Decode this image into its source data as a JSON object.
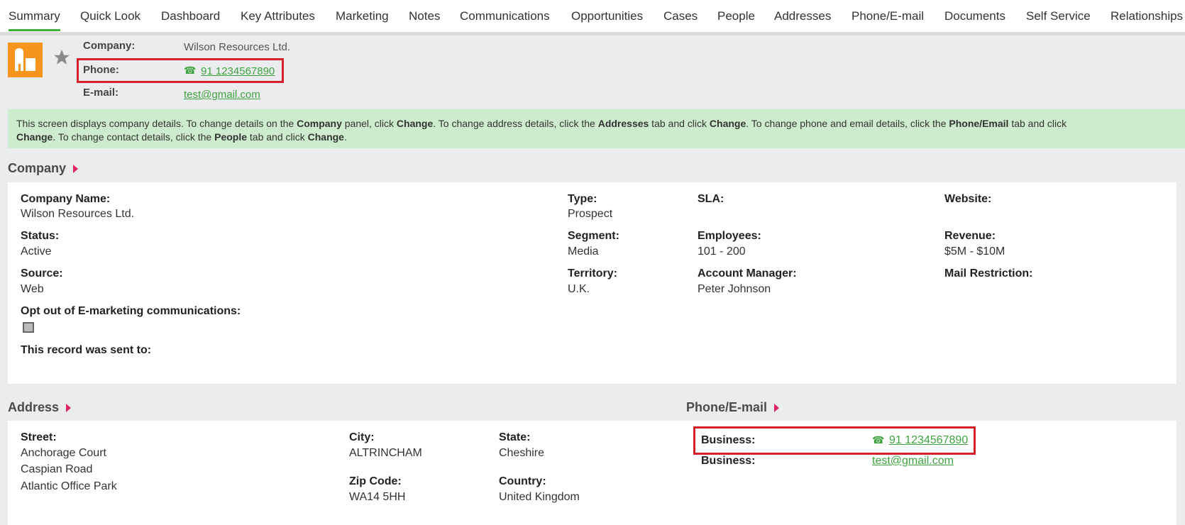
{
  "tabs": [
    "Summary",
    "Quick Look",
    "Dashboard",
    "Key Attributes",
    "Marketing",
    "Notes",
    "Communications",
    "Opportunities",
    "Cases",
    "People",
    "Addresses",
    "Phone/E-mail",
    "Documents",
    "Self Service",
    "Relationships"
  ],
  "header": {
    "company_label": "Company:",
    "company": "Wilson Resources Ltd.",
    "phone_label": "Phone:",
    "phone": "91 1234567890",
    "email_label": "E-mail:",
    "email": "test@gmail.com"
  },
  "notice": {
    "p1": "This screen displays company details. To change details on the ",
    "b1": "Company",
    "p2": " panel, click ",
    "b2": "Change",
    "p3": ". To change address details, click the ",
    "b3": "Addresses",
    "p4": " tab and click ",
    "b4": "Change",
    "p5": ". To change phone and email details, click the ",
    "b5": "Phone/Email",
    "p6": " tab and click ",
    "b6": "Change",
    "p7": ". To change contact details, click the ",
    "b7": "People",
    "p8": " tab and click ",
    "b8": "Change",
    "p9": "."
  },
  "company": {
    "heading": "Company",
    "name_label": "Company Name:",
    "name": "Wilson Resources Ltd.",
    "status_label": "Status:",
    "status": "Active",
    "source_label": "Source:",
    "source": "Web",
    "optout_label": "Opt out of E-marketing communications:",
    "sent_label": "This record was sent to:",
    "type_label": "Type:",
    "type": "Prospect",
    "segment_label": "Segment:",
    "segment": "Media",
    "territory_label": "Territory:",
    "territory": "U.K.",
    "sla_label": "SLA:",
    "employees_label": "Employees:",
    "employees": "101 - 200",
    "manager_label": "Account Manager:",
    "manager": "Peter Johnson",
    "website_label": "Website:",
    "revenue_label": "Revenue:",
    "revenue": "$5M - $10M",
    "mail_label": "Mail Restriction:"
  },
  "address": {
    "heading": "Address",
    "street_label": "Street:",
    "street": [
      "Anchorage Court",
      "Caspian Road",
      "Atlantic Office Park"
    ],
    "city_label": "City:",
    "city": "ALTRINCHAM",
    "zip_label": "Zip Code:",
    "zip": "WA14 5HH",
    "state_label": "State:",
    "state": "Cheshire",
    "country_label": "Country:",
    "country": "United Kingdom"
  },
  "phone_email": {
    "heading": "Phone/E-mail",
    "phone_label": "Business:",
    "phone": "91 1234567890",
    "email_label": "Business:",
    "email": "test@gmail.com"
  },
  "colors": {
    "accent": "#3cb43c",
    "link": "#3ea33e",
    "highlight": "#d6202a",
    "icon": "#f7941d"
  }
}
